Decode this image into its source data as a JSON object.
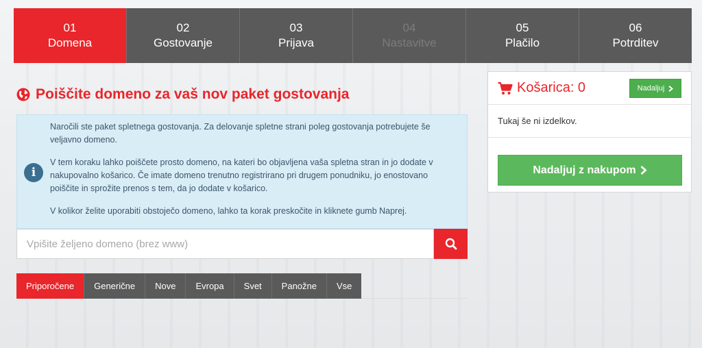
{
  "steps": [
    {
      "num": "01",
      "label": "Domena",
      "state": "active"
    },
    {
      "num": "02",
      "label": "Gostovanje",
      "state": "normal"
    },
    {
      "num": "03",
      "label": "Prijava",
      "state": "normal"
    },
    {
      "num": "04",
      "label": "Nastavitve",
      "state": "disabled"
    },
    {
      "num": "05",
      "label": "Plačilo",
      "state": "normal"
    },
    {
      "num": "06",
      "label": "Potrditev",
      "state": "normal"
    }
  ],
  "main": {
    "title": "Poiščite domeno za vaš nov paket gostovanja",
    "info": {
      "p1": "Naročili ste paket spletnega gostovanja. Za delovanje spletne strani poleg gostovanja potrebujete še veljavno domeno.",
      "p2": "V tem koraku lahko poiščete prosto domeno, na kateri bo objavljena vaša spletna stran in jo dodate v nakupovalno košarico. Če imate domeno trenutno registrirano pri drugem ponudniku, jo enostovano poiščite in sprožite prenos s tem, da jo dodate v košarico.",
      "p3": "V kolikor želite uporabiti obstoječo domeno, lahko ta korak preskočite in kliknete gumb Naprej."
    },
    "search": {
      "placeholder": "Vpišite željeno domeno (brez www)",
      "value": ""
    },
    "tld_tabs": [
      "Priporočene",
      "Generične",
      "Nove",
      "Evropa",
      "Svet",
      "Panožne",
      "Vse"
    ],
    "tld_active": 0
  },
  "cart": {
    "title": "Košarica: 0",
    "continue_small": "Nadaljuj",
    "empty_text": "Tukaj še ni izdelkov.",
    "continue_big": "Nadaljuj z nakupom"
  },
  "colors": {
    "accent": "#e8262b",
    "step_bg": "#5a5a5a",
    "success": "#5cb85c",
    "info_bg": "#d9edf7"
  },
  "icons": {
    "globe": "globe-icon",
    "info": "info-icon",
    "search": "search-icon",
    "cart": "cart-icon",
    "chevron": "chevron-right-icon"
  }
}
